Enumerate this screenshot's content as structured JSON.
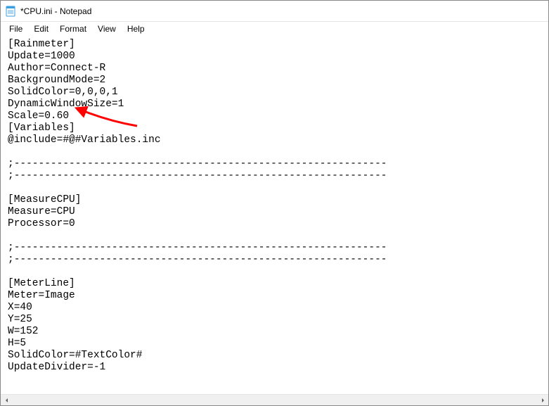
{
  "window": {
    "title": "*CPU.ini - Notepad"
  },
  "menubar": {
    "file": "File",
    "edit": "Edit",
    "format": "Format",
    "view": "View",
    "help": "Help"
  },
  "editor": {
    "text": "[Rainmeter]\nUpdate=1000\nAuthor=Connect-R\nBackgroundMode=2\nSolidColor=0,0,0,1\nDynamicWindowSize=1\nScale=0.60\n[Variables]\n@include=#@#Variables.inc\n\n;-------------------------------------------------------------\n;-------------------------------------------------------------\n\n[MeasureCPU]\nMeasure=CPU\nProcessor=0\n\n;-------------------------------------------------------------\n;-------------------------------------------------------------\n\n[MeterLine]\nMeter=Image\nX=40\nY=25\nW=152\nH=5\nSolidColor=#TextColor#\nUpdateDivider=-1"
  },
  "arrow": {
    "color": "#ff0000"
  }
}
